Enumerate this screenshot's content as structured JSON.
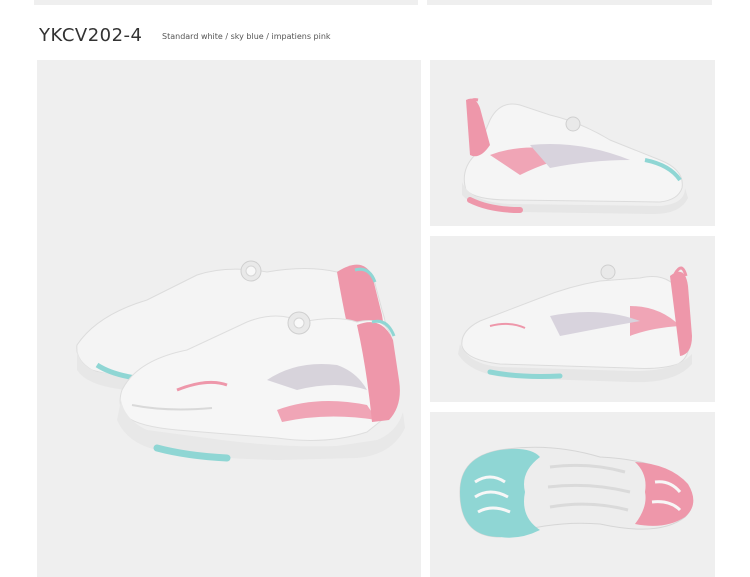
{
  "product": {
    "model": "YKCV202-4",
    "colorway": "Standard white / sky blue / impatiens pink"
  },
  "colors": {
    "panel_bg": "#efefef",
    "shoe_white": "#f5f5f5",
    "sky_blue": "#8fd6d4",
    "impatiens_pink": "#ee97aa",
    "text": "#333333"
  },
  "gallery": [
    {
      "view": "pair-three-quarter"
    },
    {
      "view": "lateral-side"
    },
    {
      "view": "medial-side"
    },
    {
      "view": "outsole"
    }
  ]
}
